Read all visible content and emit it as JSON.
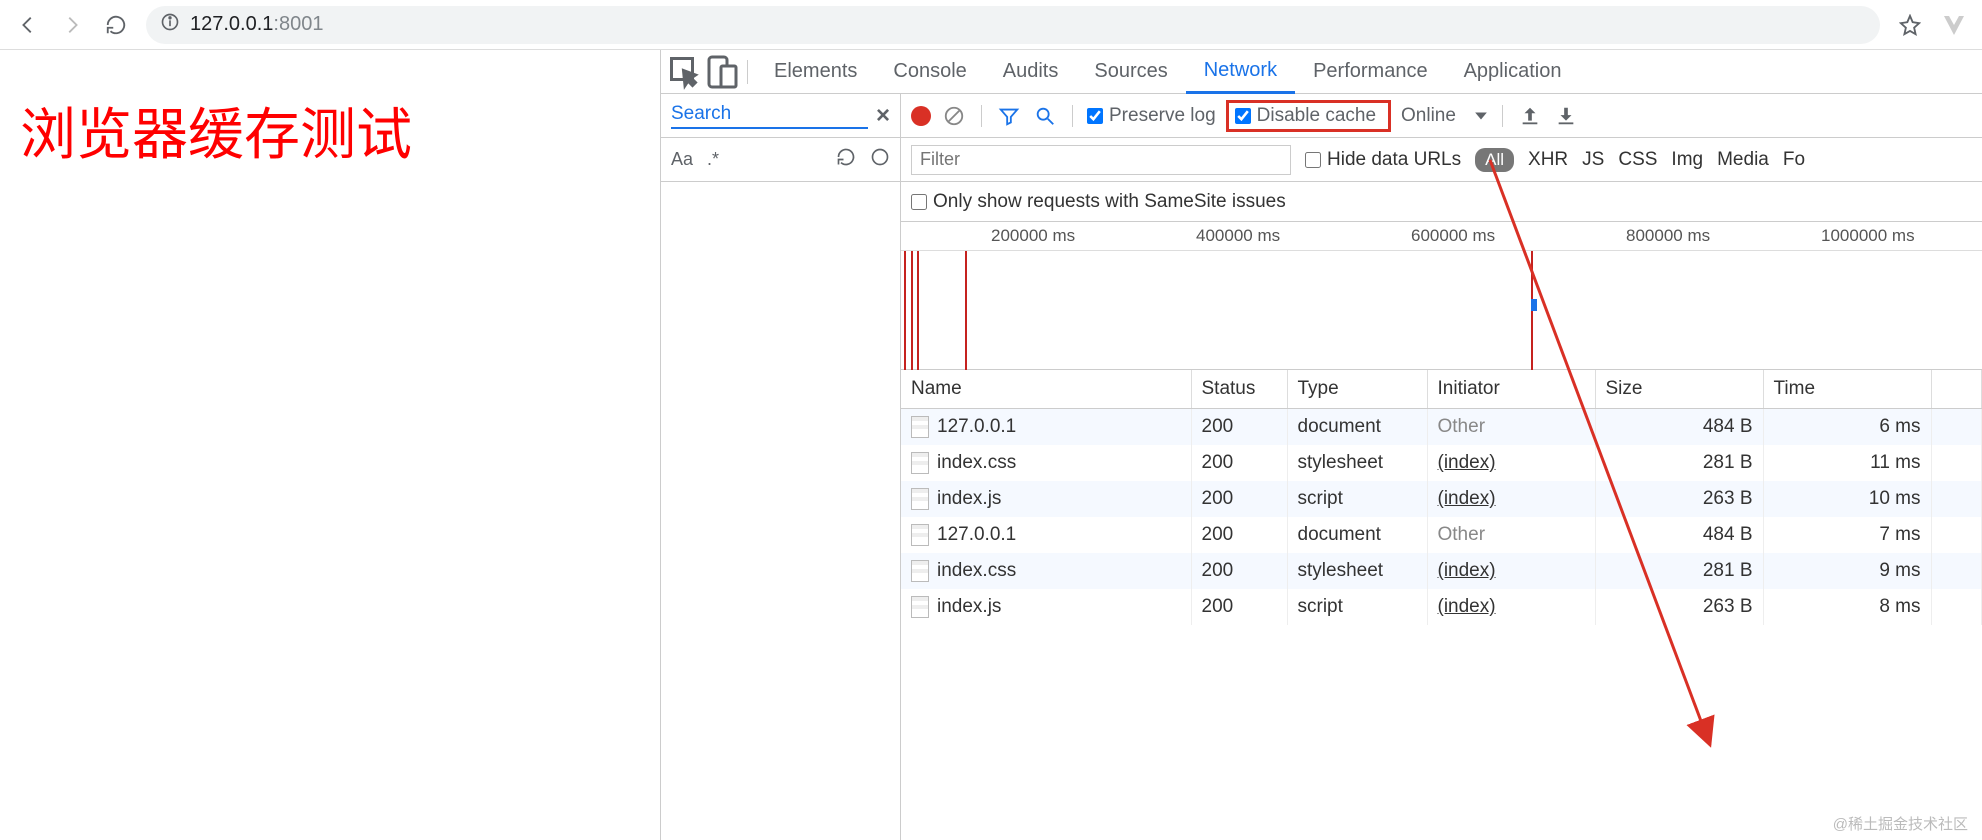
{
  "browser": {
    "address_host": "127.0.0.1",
    "address_port": ":8001"
  },
  "page": {
    "title": "浏览器缓存测试"
  },
  "devtools": {
    "tabs": [
      "Elements",
      "Console",
      "Audits",
      "Sources",
      "Network",
      "Performance",
      "Application"
    ],
    "active_tab": "Network",
    "search_label": "Search",
    "search_tools": {
      "aa": "Aa",
      "dotstar": ".*"
    }
  },
  "net_toolbar": {
    "preserve_log": "Preserve log",
    "disable_cache": "Disable cache",
    "throttle": "Online",
    "filter_placeholder": "Filter",
    "hide_data_urls": "Hide data URLs",
    "types": [
      "All",
      "XHR",
      "JS",
      "CSS",
      "Img",
      "Media",
      "Fo"
    ],
    "samesite": "Only show requests with SameSite issues"
  },
  "timeline_ticks": [
    "200000 ms",
    "400000 ms",
    "600000 ms",
    "800000 ms",
    "1000000 ms"
  ],
  "columns": [
    "Name",
    "Status",
    "Type",
    "Initiator",
    "Size",
    "Time"
  ],
  "rows": [
    {
      "name": "127.0.0.1",
      "status": "200",
      "type": "document",
      "initiator": "Other",
      "initiator_link": false,
      "size": "484 B",
      "time": "6 ms"
    },
    {
      "name": "index.css",
      "status": "200",
      "type": "stylesheet",
      "initiator": "(index)",
      "initiator_link": true,
      "size": "281 B",
      "time": "11 ms"
    },
    {
      "name": "index.js",
      "status": "200",
      "type": "script",
      "initiator": "(index)",
      "initiator_link": true,
      "size": "263 B",
      "time": "10 ms"
    },
    {
      "name": "127.0.0.1",
      "status": "200",
      "type": "document",
      "initiator": "Other",
      "initiator_link": false,
      "size": "484 B",
      "time": "7 ms"
    },
    {
      "name": "index.css",
      "status": "200",
      "type": "stylesheet",
      "initiator": "(index)",
      "initiator_link": true,
      "size": "281 B",
      "time": "9 ms"
    },
    {
      "name": "index.js",
      "status": "200",
      "type": "script",
      "initiator": "(index)",
      "initiator_link": true,
      "size": "263 B",
      "time": "8 ms"
    }
  ],
  "watermark": "@稀土掘金技术社区"
}
